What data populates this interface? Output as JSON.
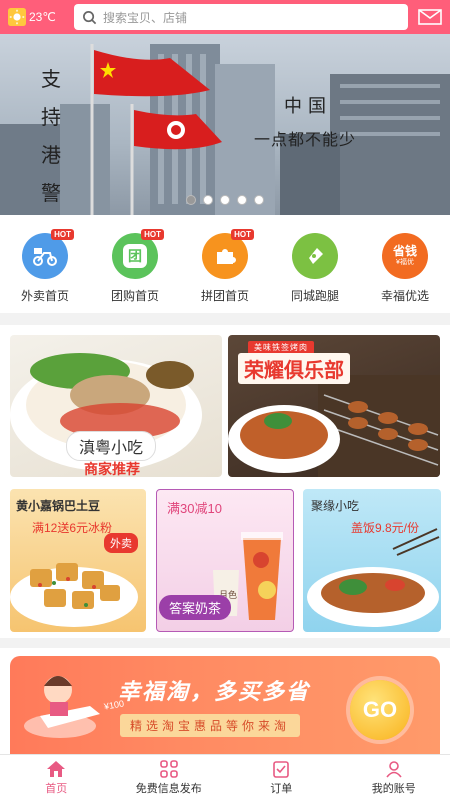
{
  "header": {
    "weather_icon": "sun-icon",
    "temperature": "23℃",
    "search_placeholder": "搜索宝贝、店铺",
    "mail_icon": "mail-icon",
    "bg_color": "#ff5e7a"
  },
  "banner": {
    "left_text": "支持港警",
    "right_line1": "中国",
    "right_line2": "一点都不能少",
    "dots_total": 5,
    "active_dot": 1
  },
  "quicknav": [
    {
      "label": "外卖首页",
      "icon": "scooter-icon",
      "badge": "HOT",
      "color": "#4f9be8"
    },
    {
      "label": "团购首页",
      "icon": "group-buy-icon",
      "icon_text": "团",
      "badge": "HOT",
      "color": "#5bc35b"
    },
    {
      "label": "拼团首页",
      "icon": "puzzle-icon",
      "badge": "HOT",
      "color": "#f7931e"
    },
    {
      "label": "同城跑腿",
      "icon": "running-icon",
      "badge": "",
      "color": "#7cc142"
    },
    {
      "label": "幸福优选",
      "icon": "save-money-icon",
      "icon_text": "省钱",
      "icon_sub": "¥福优",
      "badge": "",
      "color": "#f26b21"
    }
  ],
  "promo": {
    "card_a": {
      "pill": "滇粤小吃",
      "merchant": "商家推荐"
    },
    "card_b": {
      "tag": "美味铁签烤肉",
      "title": "荣耀俱乐部"
    },
    "card_c": {
      "title": "黄小嘉锅巴土豆",
      "price": "满12送6元冰粉",
      "badge": "外卖"
    },
    "card_d": {
      "title": "满30减10",
      "cup_text": "月色",
      "label": "答案奶茶"
    },
    "card_e": {
      "title": "聚缘小吃",
      "price": "盖饭9.8元/份"
    }
  },
  "xingfu": {
    "title": "幸福淘，多买多省",
    "subtitle": "精选淘宝惠品等你来淘",
    "go": "GO",
    "coin_text": "¥100"
  },
  "bottomnav": [
    {
      "label": "首页",
      "icon": "home-icon",
      "active": true
    },
    {
      "label": "免费信息发布",
      "icon": "grid-icon",
      "active": false
    },
    {
      "label": "订单",
      "icon": "order-icon",
      "active": false
    },
    {
      "label": "我的账号",
      "icon": "user-icon",
      "active": false
    }
  ],
  "colors": {
    "accent": "#ff5e7a",
    "active_tab": "#e85a83",
    "promo_red": "#e8392f"
  }
}
